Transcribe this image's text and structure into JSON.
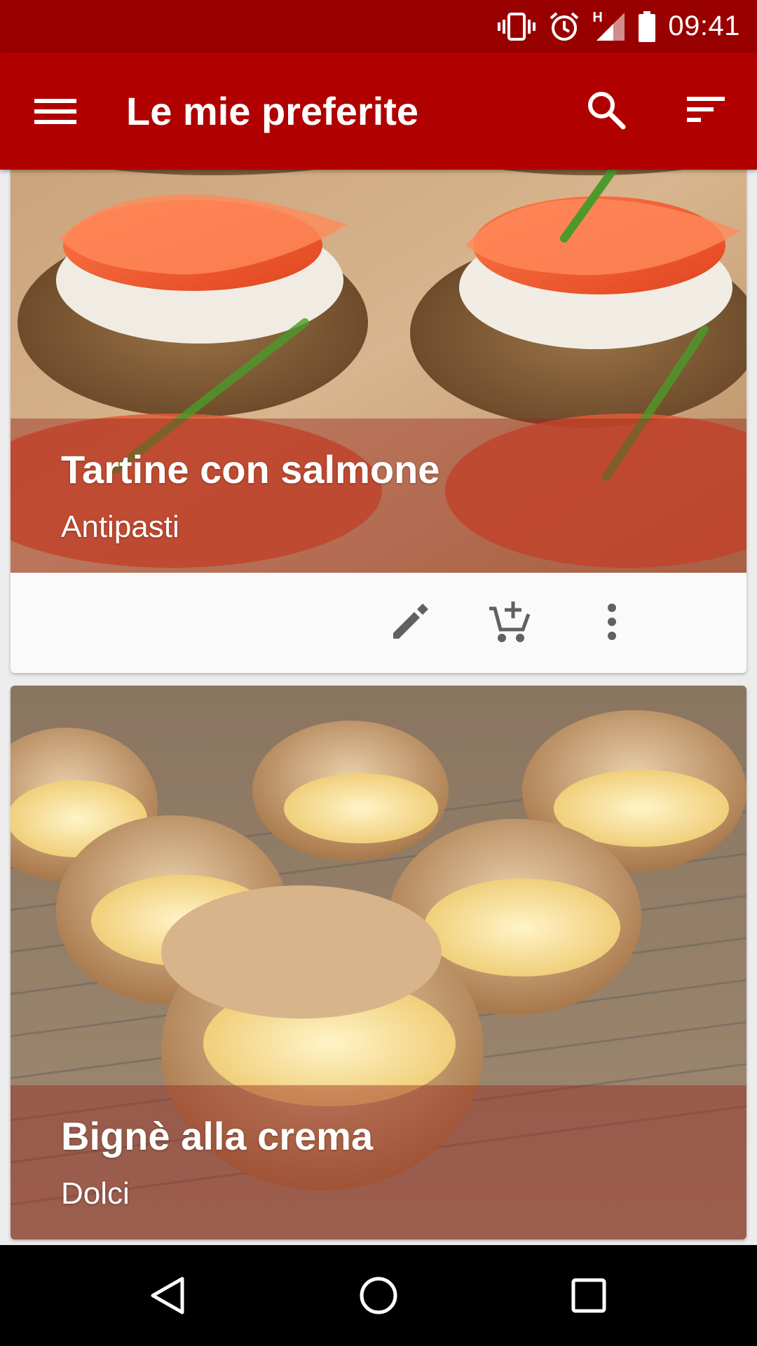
{
  "status_bar": {
    "time": "09:41",
    "network_label": "H",
    "icons": [
      "vibrate-icon",
      "alarm-icon",
      "signal-icon",
      "battery-icon"
    ]
  },
  "app_bar": {
    "title": "Le mie preferite",
    "icons": [
      "menu-icon",
      "search-icon",
      "sort-icon"
    ]
  },
  "recipes": [
    {
      "title": "Tartine con salmone",
      "category": "Antipasti",
      "actions": [
        "edit-icon",
        "add-to-cart-icon",
        "more-vert-icon"
      ]
    },
    {
      "title": "Bignè alla crema",
      "category": "Dolci"
    }
  ],
  "nav_bar": {
    "icons": [
      "back-icon",
      "home-icon",
      "recents-icon"
    ]
  },
  "colors": {
    "status_bar": "#990000",
    "app_bar": "#b00000",
    "caption_overlay": "#96281e",
    "action_icon": "#616161"
  }
}
